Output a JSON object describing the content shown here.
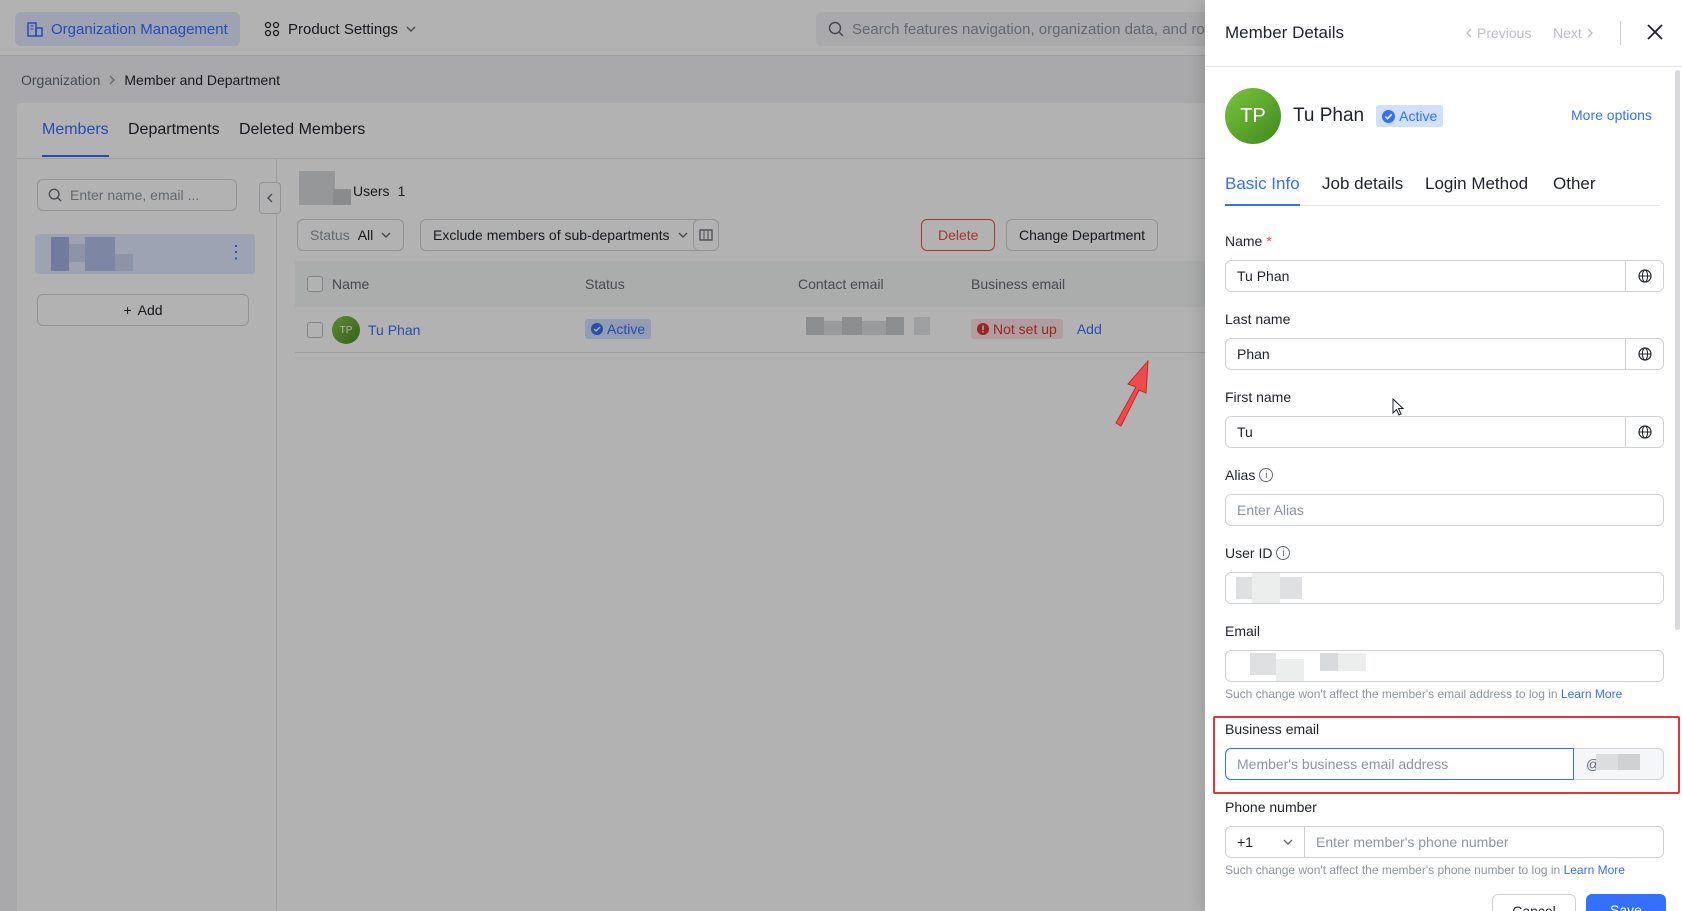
{
  "topbar": {
    "org_label": "Organization Management",
    "product_label": "Product Settings",
    "search_placeholder": "Search features navigation, organization data, and role..."
  },
  "breadcrumb": {
    "root": "Organization",
    "current": "Member and Department"
  },
  "tabs": [
    "Members",
    "Departments",
    "Deleted Members"
  ],
  "left_panel": {
    "search_placeholder": "Enter name, email ...",
    "add_label": "Add"
  },
  "toolbar": {
    "users_label": "Users",
    "users_count": "1",
    "status_label": "Status",
    "status_value": "All",
    "sub_dept_filter": "Exclude members of sub-departments",
    "delete_label": "Delete",
    "change_dept_label": "Change Department"
  },
  "table": {
    "headers": [
      "Name",
      "Status",
      "Contact email",
      "Business email"
    ],
    "rows": [
      {
        "initials": "TP",
        "name": "Tu Phan",
        "status": "Active",
        "business_email_status": "Not set up",
        "business_email_action": "Add"
      }
    ]
  },
  "drawer": {
    "title": "Member Details",
    "previous": "Previous",
    "next": "Next",
    "initials": "TP",
    "name": "Tu Phan",
    "status": "Active",
    "more_options": "More options",
    "tabs": [
      "Basic Info",
      "Job details",
      "Login Method",
      "Other"
    ],
    "fields": {
      "name_label": "Name",
      "name_value": "Tu Phan",
      "last_name_label": "Last name",
      "last_name_value": "Phan",
      "first_name_label": "First name",
      "first_name_value": "Tu",
      "alias_label": "Alias",
      "alias_placeholder": "Enter Alias",
      "user_id_label": "User ID",
      "email_label": "Email",
      "email_help": "Such change won't affect the member's email address to log in",
      "learn_more": "Learn More",
      "business_email_label": "Business email",
      "business_email_placeholder": "Member's business email address",
      "business_email_domain": "@",
      "phone_label": "Phone number",
      "country_code": "+1",
      "phone_placeholder": "Enter member's phone number",
      "phone_help": "Such change won't affect the member's phone number to log in"
    },
    "cancel_label": "Cancel",
    "save_label": "Save"
  },
  "colors": {
    "accent": "#3370ff",
    "danger": "#f54a45",
    "highlight": "#e8333a"
  }
}
